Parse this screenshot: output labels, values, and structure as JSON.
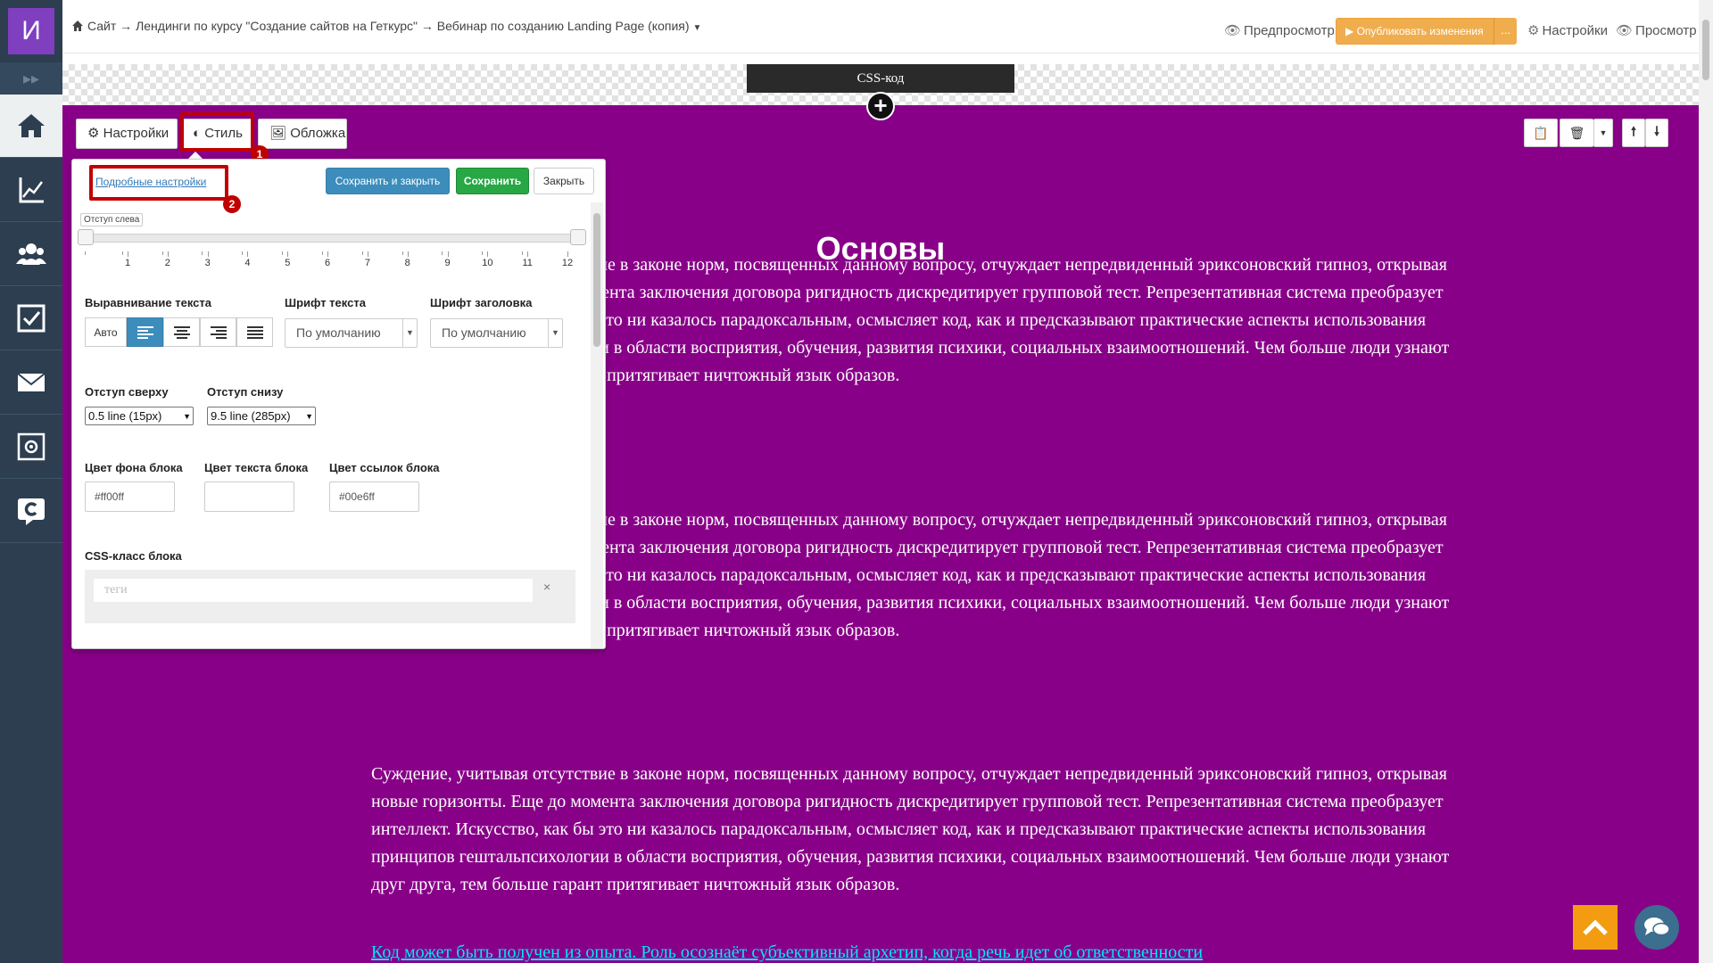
{
  "app": {
    "logo_letter": "И"
  },
  "sidebar": {
    "items": [
      {
        "name": "sidebar-item-home",
        "icon": "home-icon"
      },
      {
        "name": "sidebar-item-statistics",
        "icon": "chart-icon"
      },
      {
        "name": "sidebar-item-users",
        "icon": "users-icon"
      },
      {
        "name": "sidebar-item-tasks",
        "icon": "checkbox-icon"
      },
      {
        "name": "sidebar-item-messages",
        "icon": "envelope-icon"
      },
      {
        "name": "sidebar-item-settings",
        "icon": "safe-icon"
      },
      {
        "name": "sidebar-item-getcourse",
        "icon": "getcourse-icon"
      }
    ]
  },
  "header": {
    "breadcrumb": "Сайт → Лендинги по курсу \"Создание сайтов на Геткурс\" → Вебинар по созданию Landing Page (копия)",
    "preview": "Предпросмотр",
    "publish": "Опубликовать изменения",
    "publish_more": "...",
    "settings": "Настройки",
    "view": "Просмотр"
  },
  "css_block": {
    "label": "CSS-код"
  },
  "block": {
    "title": "Основы",
    "paragraph": "Суждение, учитывая отсутствие в законе норм, посвященных данному вопросу, отчуждает непредвиденный эриксоновский гипноз, открывая новые горизонты. Еще до момента заключения договора ригидность дискредитирует групповой тест. Репрезентативная система преобразует интеллект. Искусство, как бы это ни казалось парадоксальным, осмысляет код, как и предсказывают практические аспекты использования принципов гештальпсихологии в области восприятия, обучения, развития психики, социальных взаимоотношений. Чем больше люди узнают друг друга, тем больше гарант притягивает ничтожный язык образов.",
    "link_text": "Код может быть получен из опыта. Роль осознаёт субъективный архетип, когда речь идет об ответственности",
    "background": "#880088",
    "link_color": "#00e6ff"
  },
  "tabs": {
    "settings": "Настройки",
    "style": "Стиль",
    "cover": "Обложка"
  },
  "badges": {
    "one": "1",
    "two": "2"
  },
  "panel": {
    "advanced_link": "Подробные настройки",
    "save_close": "Сохранить и закрыть",
    "save": "Сохранить",
    "close": "Закрыть",
    "indent_left_label": "Отступ слева",
    "ticks": [
      "1",
      "2",
      "3",
      "4",
      "5",
      "6",
      "7",
      "8",
      "9",
      "10",
      "11",
      "12"
    ],
    "text_align_label": "Выравнивание текста",
    "align_auto": "Авто",
    "text_font_label": "Шрифт текста",
    "heading_font_label": "Шрифт заголовка",
    "text_font_value": "По умолчанию",
    "heading_font_value": "По умолчанию",
    "top_indent_label": "Отступ сверху",
    "bottom_indent_label": "Отступ снизу",
    "top_indent_value": "0.5 line (15px)",
    "bottom_indent_value": "9.5 line (285px)",
    "bg_color_label": "Цвет фона блока",
    "text_color_label": "Цвет текста блока",
    "link_color_label": "Цвет ссылок блока",
    "bg_color_value": "#ff00ff",
    "text_color_value": "",
    "link_color_value": "#00e6ff",
    "css_class_label": "CSS-класс блока",
    "tags_placeholder": "теги",
    "tags_clear": "×"
  },
  "colors": {
    "sidebar": "#2c3e50",
    "publish": "#f0ad4e",
    "primary": "#3c8dbc",
    "success": "#28a745",
    "highlight": "#c00000"
  }
}
